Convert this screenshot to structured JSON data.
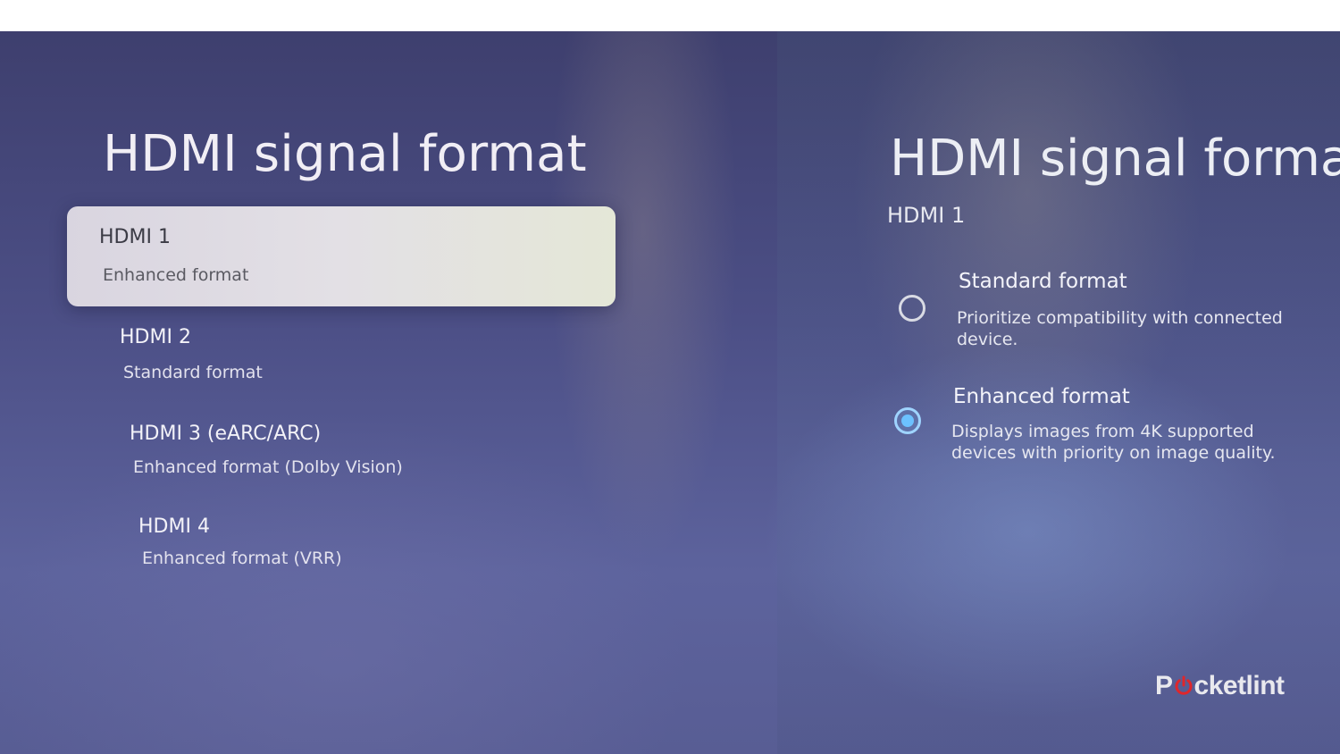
{
  "left_panel": {
    "title": "HDMI signal format",
    "items": [
      {
        "title": "HDMI 1",
        "subtitle": "Enhanced format",
        "selected": true
      },
      {
        "title": "HDMI 2",
        "subtitle": "Standard format",
        "selected": false
      },
      {
        "title": "HDMI 3 (eARC/ARC)",
        "subtitle": "Enhanced format (Dolby Vision)",
        "selected": false
      },
      {
        "title": "HDMI 4",
        "subtitle": "Enhanced format (VRR)",
        "selected": false
      }
    ]
  },
  "right_panel": {
    "title": "HDMI signal format",
    "subtitle": "HDMI 1",
    "options": [
      {
        "label": "Standard format",
        "description": "Prioritize compatibility with connected device.",
        "checked": false
      },
      {
        "label": "Enhanced format",
        "description": "Displays images from 4K supported devices with priority on image quality.",
        "checked": true
      }
    ]
  },
  "watermark": {
    "text": "Pocketlint",
    "prefix": "P",
    "suffix": "cketlint",
    "accent_color": "#e0262b"
  },
  "colors": {
    "radio_checked": "#6cc1ff",
    "selected_card": "#e3e0e5"
  }
}
